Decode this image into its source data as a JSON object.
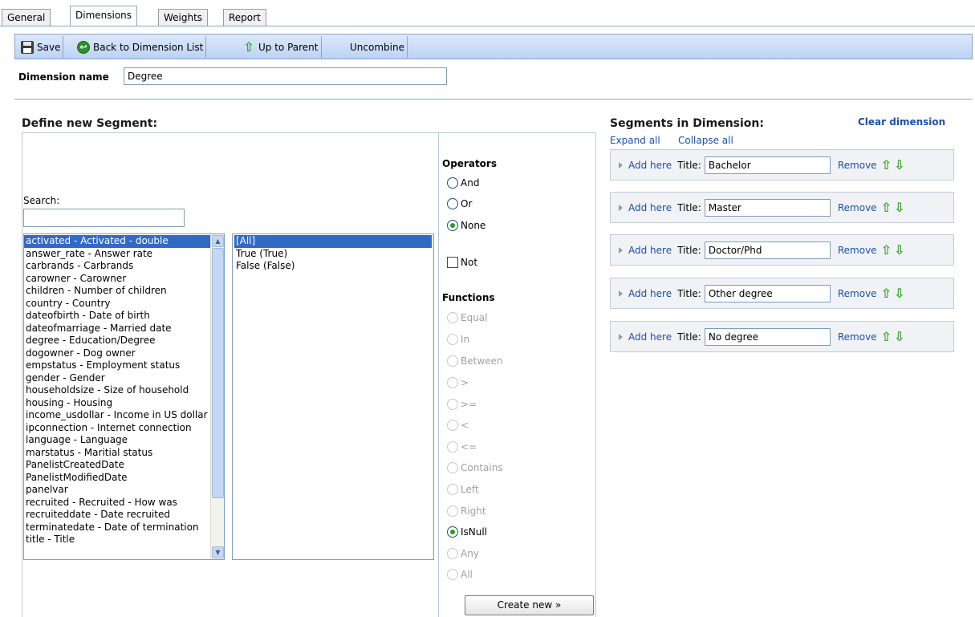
{
  "tabs": [
    {
      "label": "General"
    },
    {
      "label": "Dimensions"
    },
    {
      "label": "Weights"
    },
    {
      "label": "Report"
    }
  ],
  "toolbar": {
    "save_label": "Save",
    "back_label": "Back to Dimension List",
    "up_label": "Up to Parent",
    "uncombine_label": "Uncombine"
  },
  "dimension": {
    "name_label": "Dimension name",
    "name_value": "Degree"
  },
  "define": {
    "heading": "Define new Segment:",
    "search_label": "Search:",
    "search_value": "",
    "variables": [
      "activated - Activated - double",
      "answer_rate - Answer rate",
      "carbrands - Carbrands",
      "carowner - Carowner",
      "children - Number of children",
      "country - Country",
      "dateofbirth - Date of birth",
      "dateofmarriage - Married date",
      "degree - Education/Degree",
      "dogowner - Dog owner",
      "empstatus - Employment status",
      "gender - Gender",
      "householdsize - Size of household",
      "housing - Housing",
      "income_usdollar - Income in US dollar",
      "ipconnection - Internet connection",
      "language - Language",
      "marstatus - Maritial status",
      "PanelistCreatedDate",
      "PanelistModifiedDate",
      "panelvar",
      "recruited - Recruited - How was",
      "recruiteddate - Date recruited",
      "terminatedate - Date of termination",
      "title - Title"
    ],
    "values": [
      "[All]",
      "True (True)",
      "False (False)"
    ],
    "operators_heading": "Operators",
    "op_and": "And",
    "op_or": "Or",
    "op_none": "None",
    "not_label": "Not",
    "functions_heading": "Functions",
    "fn": {
      "equal": "Equal",
      "in": "In",
      "between": "Between",
      "gt": ">",
      "gte": ">=",
      "lt": "<",
      "lte": "<=",
      "contains": "Contains",
      "left": "Left",
      "right": "Right",
      "isnull": "IsNull",
      "any": "Any",
      "all": "All"
    },
    "create_label": "Create new »"
  },
  "segments": {
    "heading": "Segments in Dimension:",
    "clear_label": "Clear dimension",
    "expand_label": "Expand all",
    "collapse_label": "Collapse all",
    "add_label": "Add here",
    "title_label": "Title:",
    "remove_label": "Remove",
    "items": [
      {
        "title": "Bachelor"
      },
      {
        "title": "Master"
      },
      {
        "title": "Doctor/Phd"
      },
      {
        "title": "Other degree"
      },
      {
        "title": "No degree"
      }
    ]
  }
}
